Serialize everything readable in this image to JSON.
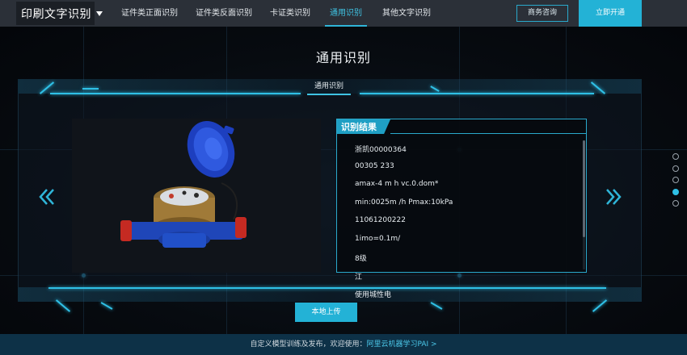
{
  "brand": {
    "title": "印刷文字识别"
  },
  "nav": {
    "tabs": [
      {
        "label": "证件类正面识别",
        "active": false
      },
      {
        "label": "证件类反面识别",
        "active": false
      },
      {
        "label": "卡证类识别",
        "active": false
      },
      {
        "label": "通用识别",
        "active": true
      },
      {
        "label": "其他文字识别",
        "active": false
      }
    ],
    "consult_label": "商务咨询",
    "open_label": "立即开通"
  },
  "page": {
    "title": "通用识别",
    "sub_tab": "通用识别"
  },
  "image": {
    "icon": "water-meter-photo"
  },
  "result": {
    "title": "识别结果",
    "lines": [
      "浙凯00000364",
      "00305 233",
      "amax-4 m h vc.0.dom*",
      "min:0025m /h Pmax:10kPa",
      "11061200222",
      "1imo=0.1m/",
      "8级",
      "江",
      "使用城性电"
    ]
  },
  "carousel": {
    "dot_count": 5,
    "active_dot": 3
  },
  "upload": {
    "label": "本地上传"
  },
  "footer": {
    "text": "自定义模型训练及发布，欢迎使用：",
    "link": "阿里云机器学习PAI >"
  },
  "colors": {
    "accent": "#23b2d6",
    "nav_bg": "#2b3038",
    "footer_bg": "#0d3147"
  }
}
